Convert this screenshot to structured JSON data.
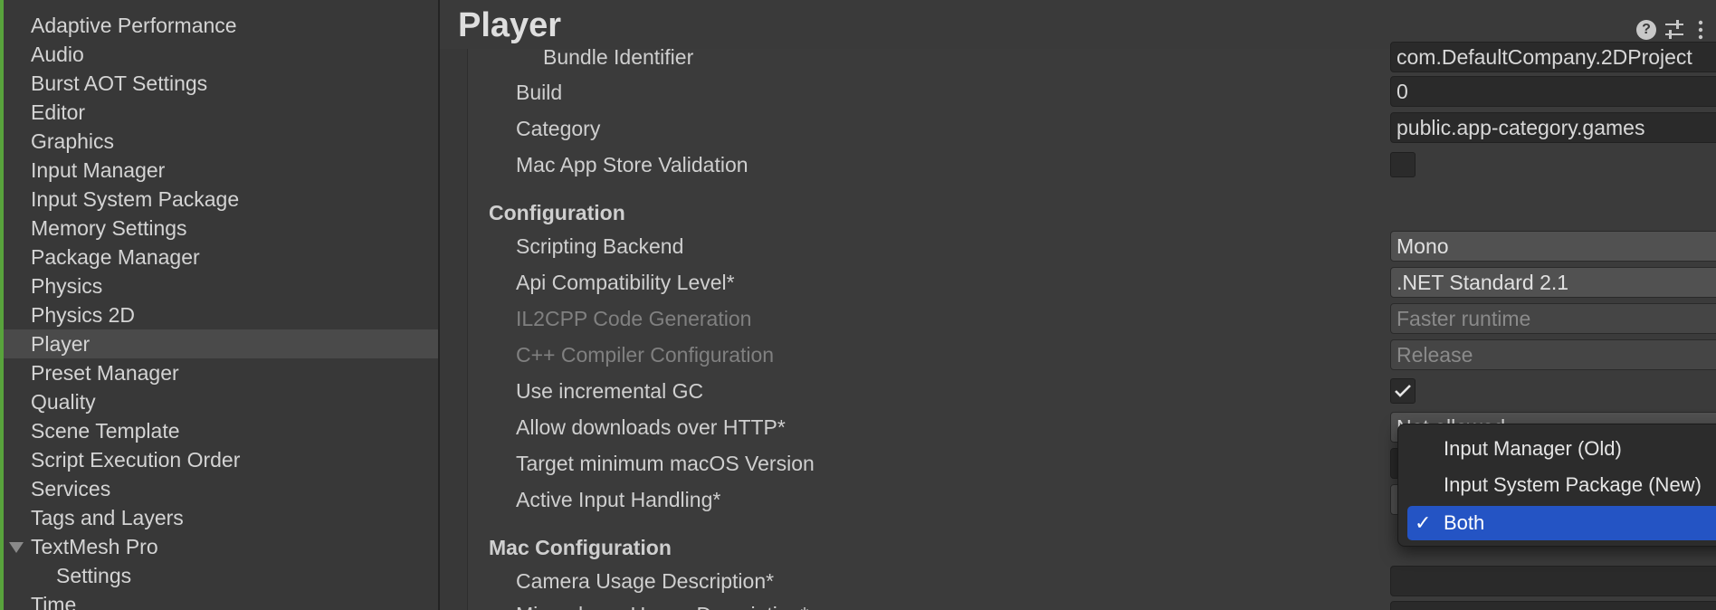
{
  "sidebar": {
    "items": [
      {
        "label": "Adaptive Performance"
      },
      {
        "label": "Audio"
      },
      {
        "label": "Burst AOT Settings"
      },
      {
        "label": "Editor"
      },
      {
        "label": "Graphics"
      },
      {
        "label": "Input Manager"
      },
      {
        "label": "Input System Package"
      },
      {
        "label": "Memory Settings"
      },
      {
        "label": "Package Manager"
      },
      {
        "label": "Physics"
      },
      {
        "label": "Physics 2D"
      },
      {
        "label": "Player",
        "selected": true
      },
      {
        "label": "Preset Manager"
      },
      {
        "label": "Quality"
      },
      {
        "label": "Scene Template"
      },
      {
        "label": "Script Execution Order"
      },
      {
        "label": "Services"
      },
      {
        "label": "Tags and Layers"
      },
      {
        "label": "TextMesh Pro",
        "expanded": true
      },
      {
        "label": "Settings",
        "child": true
      },
      {
        "label": "Time"
      }
    ]
  },
  "header": {
    "title": "Player",
    "help_glyph": "?",
    "icons": [
      "help-icon",
      "preset-sliders-icon",
      "context-menu-icon"
    ]
  },
  "identification": {
    "bundle_identifier_label": "Bundle Identifier",
    "bundle_identifier_value": "com.DefaultCompany.2DProject",
    "build_label": "Build",
    "build_value": "0",
    "category_label": "Category",
    "category_value": "public.app-category.games",
    "mac_app_store_validation_label": "Mac App Store Validation",
    "mac_app_store_validation_checked": false
  },
  "configuration": {
    "header": "Configuration",
    "scripting_backend_label": "Scripting Backend",
    "scripting_backend_value": "Mono",
    "api_compat_label": "Api Compatibility Level*",
    "api_compat_value": ".NET Standard 2.1",
    "il2cpp_codegen_label": "IL2CPP Code Generation",
    "il2cpp_codegen_value": "Faster runtime",
    "cpp_compiler_label": "C++ Compiler Configuration",
    "cpp_compiler_value": "Release",
    "incremental_gc_label": "Use incremental GC",
    "incremental_gc_checked": true,
    "allow_http_label": "Allow downloads over HTTP*",
    "allow_http_value": "Not allowed",
    "target_macos_label": "Target minimum macOS Version",
    "active_input_label": "Active Input Handling*"
  },
  "mac_configuration": {
    "header": "Mac Configuration",
    "camera_usage_label": "Camera Usage Description*",
    "camera_usage_value": "",
    "microphone_usage_label": "Microphone Usage Description*"
  },
  "input_handling_popup": {
    "options": [
      {
        "label": "Input Manager (Old)",
        "selected": false
      },
      {
        "label": "Input System Package (New)",
        "selected": false
      },
      {
        "label": "Both",
        "selected": true
      }
    ],
    "check_glyph": "✓"
  },
  "colors": {
    "accent_selection": "#2454c4",
    "sidebar_edge": "#58a33c",
    "background": "#383838"
  }
}
